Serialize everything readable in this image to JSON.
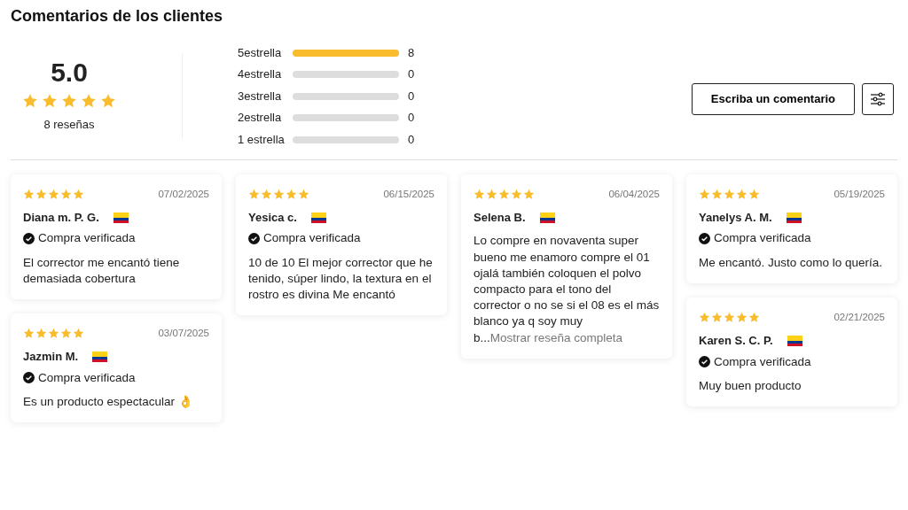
{
  "title": "Comentarios de los clientes",
  "summary": {
    "average": "5.0",
    "stars": 5,
    "count_label": "8 reseñas"
  },
  "distribution": [
    {
      "label": "5estrella",
      "level": 1,
      "count": "8"
    },
    {
      "label": "4estrella",
      "level": 0,
      "count": "0"
    },
    {
      "label": "3estrella",
      "level": 0,
      "count": "0"
    },
    {
      "label": "2estrella",
      "level": 0,
      "count": "0"
    },
    {
      "label": "1 estrella",
      "level": 0,
      "count": "0"
    }
  ],
  "write_button": "Escriba un comentario",
  "review_columns": [
    [
      {
        "stars": 5,
        "date": "07/02/2025",
        "name": "Diana m. P. G.",
        "verified": true,
        "verified_label": "Compra verificada",
        "text": "El corrector me encantó tiene demasiada cobertura"
      },
      {
        "stars": 5,
        "date": "03/07/2025",
        "name": "Jazmin M.",
        "verified": true,
        "verified_label": "Compra verificada",
        "text": "Es un producto espectacular 👌"
      }
    ],
    [
      {
        "stars": 5,
        "date": "06/15/2025",
        "name": "Yesica c.",
        "verified": true,
        "verified_label": "Compra verificada",
        "text": "10 de 10 El mejor corrector que he tenido, súper lindo, la textura en el rostro es divina Me encantó"
      }
    ],
    [
      {
        "stars": 5,
        "date": "06/04/2025",
        "name": "Selena B.",
        "verified": false,
        "text": "Lo compre en novaventa super bueno me enamoro compre el 01 ojalá también coloquen el polvo compacto para el tono del corrector o no se si el 08 es el más blanco ya q soy muy b...",
        "more_link": "Mostrar reseña completa"
      }
    ],
    [
      {
        "stars": 5,
        "date": "05/19/2025",
        "name": "Yanelys A. M.",
        "verified": true,
        "verified_label": "Compra verificada",
        "text": "Me encantó. Justo como lo quería."
      },
      {
        "stars": 5,
        "date": "02/21/2025",
        "name": "Karen S. C. P.",
        "verified": true,
        "verified_label": "Compra verificada",
        "text": "Muy buen producto"
      }
    ]
  ]
}
